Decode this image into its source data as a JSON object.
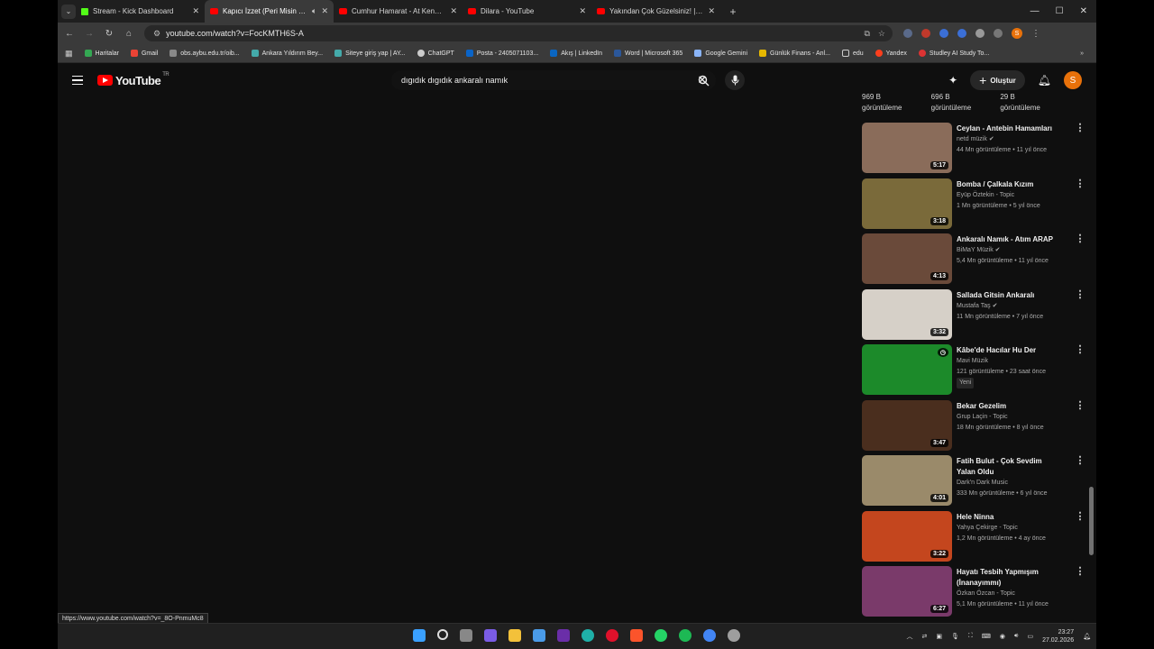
{
  "browser": {
    "tabs": [
      {
        "title": "Stream - Kick Dashboard",
        "favicon": "kick-icon",
        "active": false
      },
      {
        "title": "Kapıcı İzzet (Peri Misin Cin Mi)",
        "favicon": "youtube-icon",
        "active": true,
        "audio": true
      },
      {
        "title": "Cumhur Hamarat - At Kendini Çı",
        "favicon": "youtube-icon",
        "active": false
      },
      {
        "title": "Dilara - YouTube",
        "favicon": "youtube-icon",
        "active": false
      },
      {
        "title": "Yakından Çok Güzelsiniz! | Mar",
        "favicon": "youtube-icon",
        "active": false
      }
    ],
    "new_tab": "+",
    "url": "youtube.com/watch?v=FocKMTH6S-A",
    "bookmarks": [
      "Haritalar",
      "Gmail",
      "obs.aybu.edu.tr/oib...",
      "Ankara Yıldırım Bey...",
      "Siteye giriş yap | AY...",
      "ChatGPT",
      "Posta - 2405071103...",
      "Akış | LinkedIn",
      "Word | Microsoft 365",
      "Google Gemini",
      "Günlük Finans - Anl...",
      "edu",
      "Yandex",
      "Studley AI Study To..."
    ],
    "profile_initial": "S",
    "status_url": "https://www.youtube.com/watch?v=_8O-PnmuMc8"
  },
  "youtube": {
    "logo_text": "YouTube",
    "region": "TR",
    "search_query": "dıgıdık dıgıdık ankaralı namık",
    "create_label": "Oluştur",
    "avatar_initial": "S",
    "prev_views": [
      {
        "count": "969 B",
        "label": "görüntüleme"
      },
      {
        "count": "696 B",
        "label": "görüntüleme"
      },
      {
        "count": "29 B",
        "label": "görüntüleme"
      }
    ],
    "recommendations": [
      {
        "title": "Ceylan - Antebin Hamamları",
        "channel": "netd müzik",
        "verified": true,
        "stats": "44 Mn görüntüleme • 11 yıl önce",
        "duration": "5:17",
        "thumb_color": "#8a6c5a"
      },
      {
        "title": "Bomba / Çalkala Kızım",
        "channel": "Eyüp Öztekin - Topic",
        "verified": false,
        "stats": "1 Mn görüntüleme • 5 yıl önce",
        "duration": "3:18",
        "thumb_color": "#7a6a3a"
      },
      {
        "title": "Ankaralı Namık - Atım ARAP",
        "channel": "BiMaY Müzik",
        "verified": true,
        "stats": "5,4 Mn görüntüleme • 11 yıl önce",
        "duration": "4:13",
        "thumb_color": "#6a4a3a"
      },
      {
        "title": "Sallada Gitsin Ankaralı",
        "channel": "Mustafa Taş",
        "verified": true,
        "stats": "11 Mn görüntüleme • 7 yıl önce",
        "duration": "3:32",
        "thumb_color": "#d6d0c8"
      },
      {
        "title": "Kâbe'de Hacılar Hu Der",
        "channel": "Mavi Müzik",
        "verified": false,
        "stats": "121 görüntüleme • 23 saat önce",
        "duration": "",
        "badge": "Yeni",
        "thumb_color": "#1c8a2a"
      },
      {
        "title": "Bekar Gezelim",
        "channel": "Grup Laçin - Topic",
        "verified": false,
        "stats": "18 Mn görüntüleme • 8 yıl önce",
        "duration": "3:47",
        "thumb_color": "#4a2e1e"
      },
      {
        "title": "Fatih Bulut - Çok Sevdim Yalan Oldu",
        "channel": "Dark'n Dark Music",
        "verified": false,
        "stats": "333 Mn görüntüleme • 6 yıl önce",
        "duration": "4:01",
        "thumb_color": "#9a8a6a"
      },
      {
        "title": "Hele Ninna",
        "channel": "Yahya Çekirge - Topic",
        "verified": false,
        "stats": "1,2 Mn görüntüleme • 4 ay önce",
        "duration": "3:22",
        "thumb_color": "#c4461e"
      },
      {
        "title": "Hayatı Tesbih Yapmışım (İnanayımmı)",
        "channel": "Özkan Özcan - Topic",
        "verified": false,
        "stats": "5,1 Mn görüntüleme • 11 yıl önce",
        "duration": "6:27",
        "thumb_color": "#7a3a6a"
      }
    ]
  },
  "taskbar": {
    "time": "23:27",
    "date": "27.02.2026"
  }
}
